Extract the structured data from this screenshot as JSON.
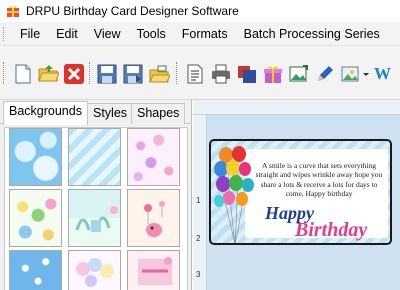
{
  "window": {
    "title": "DRPU Birthday Card Designer Software"
  },
  "menu": [
    "File",
    "Edit",
    "View",
    "Tools",
    "Formats",
    "Batch Processing Series"
  ],
  "toolbar": {
    "icons": [
      "new-file-icon",
      "open-folder-icon",
      "close-icon",
      "save-icon",
      "save-as-icon",
      "open-template-icon",
      "page-properties-icon",
      "print-icon",
      "print-preview-icon",
      "gift-icon",
      "insert-image-icon",
      "pen-icon",
      "image-landscape-icon",
      "text-art-icon"
    ],
    "wordart_glyph": "W"
  },
  "left_panel": {
    "tabs": [
      "Backgrounds",
      "Styles",
      "Shapes"
    ],
    "active_tab": "Backgrounds"
  },
  "ruler": {
    "left_numbers": [
      "1",
      "2",
      "3"
    ]
  },
  "card": {
    "quote": "A smile is a curve that sets everything straight and wipes wrinkle away hope you share a lots & receive a lots for days to come, Happy birthday",
    "happy": "Happy",
    "birthday": "Birthday"
  },
  "colors": {
    "accent_blue": "#1d3f8f",
    "accent_pink": "#e23d8f",
    "close_red": "#d9342b"
  }
}
